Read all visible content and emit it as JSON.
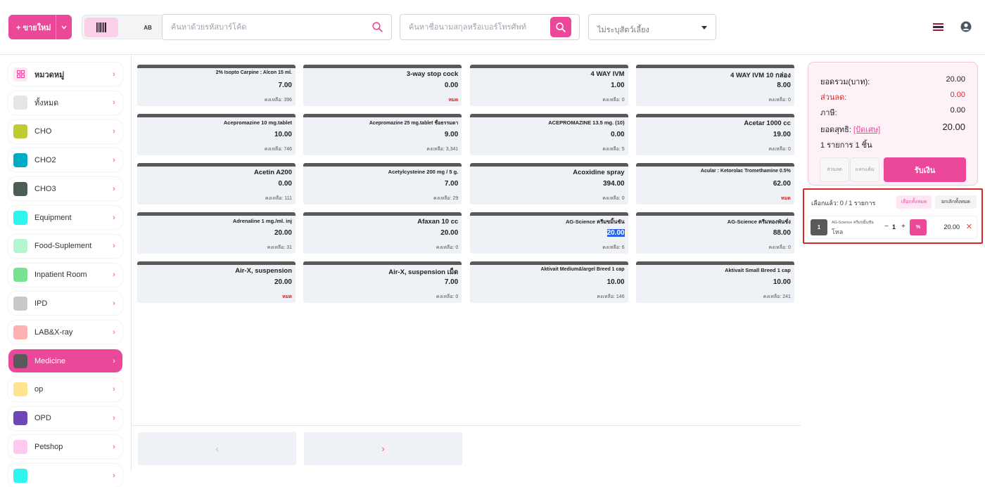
{
  "header": {
    "new_sale_label": "+ ขายใหม่",
    "mode_ab_label": "AB",
    "barcode_placeholder": "ค้นหาด้วยรหัสบาร์โค้ด",
    "customer_placeholder": "ค้นหาชื่อนามสกุลหรือเบอร์โทรศัพท์",
    "pet_select_value": "ไม่ระบุสัตว์เลี้ยง",
    "accent": "#ec4899"
  },
  "sidebar": {
    "items": [
      {
        "label": "หมวดหมู่",
        "color": "#fce7f3",
        "icon": "grid-icon"
      },
      {
        "label": "ทั้งหมด",
        "color": "#e5e5e5"
      },
      {
        "label": "CHO",
        "color": "#c0ca33"
      },
      {
        "label": "CHO2",
        "color": "#00acc1"
      },
      {
        "label": "CHO3",
        "color": "#4a5f52"
      },
      {
        "label": "Equipment",
        "color": "#2ff5ef"
      },
      {
        "label": "Food-Suplement",
        "color": "#b3f5cf"
      },
      {
        "label": "Inpatient Room",
        "color": "#77e28f"
      },
      {
        "label": "IPD",
        "color": "#c9c9c9"
      },
      {
        "label": "LAB&X-ray",
        "color": "#ffb0b0"
      },
      {
        "label": "Medicine",
        "color": "#595959",
        "active": true
      },
      {
        "label": "op",
        "color": "#ffe38f"
      },
      {
        "label": "OPD",
        "color": "#6e46b8"
      },
      {
        "label": "Petshop",
        "color": "#ffcaf0"
      },
      {
        "label": "",
        "color": "#2ff5ef"
      }
    ]
  },
  "products": [
    {
      "name": "2% Isopto Carpine : Alcon 15 ml.",
      "price": "7.00",
      "stock": "คงเหลือ: 396"
    },
    {
      "name": "3-way stop cock",
      "price": "0.00",
      "stock": "หมด",
      "out": true
    },
    {
      "name": "4 WAY IVM",
      "price": "1.00",
      "stock": "คงเหลือ: 0"
    },
    {
      "name": "4 WAY IVM 10 กล่อง",
      "price": "8.00",
      "stock": "คงเหลือ: 0"
    },
    {
      "name": "Acepromazine 10 mg.tablet",
      "price": "10.00",
      "stock": "คงเหลือ: 746"
    },
    {
      "name": "Acepromazine 25 mg.tablet ชื่อธรรมดา",
      "price": "9.00",
      "stock": "คงเหลือ: 3,341"
    },
    {
      "name": "ACEPROMAZINE 13.5 mg. (10)",
      "price": "0.00",
      "stock": "คงเหลือ: 5"
    },
    {
      "name": "Acetar 1000 cc",
      "price": "19.00",
      "stock": "คงเหลือ: 0"
    },
    {
      "name": "Acetin A200",
      "price": "0.00",
      "stock": "คงเหลือ: 111"
    },
    {
      "name": "Acetylcysteine 200 mg / 5 g.",
      "price": "7.00",
      "stock": "คงเหลือ: 29"
    },
    {
      "name": "Acoxidine spray",
      "price": "394.00",
      "stock": "คงเหลือ: 0"
    },
    {
      "name": "Acular : Ketorolac Tromethamine 0.5%",
      "price": "62.00",
      "stock": "หมด",
      "out": true
    },
    {
      "name": "Adrenaline 1 mg./ml. inj",
      "price": "20.00",
      "stock": "คงเหลือ: 31"
    },
    {
      "name": "Afaxan 10 cc",
      "price": "20.00",
      "stock": "คงเหลือ: 0"
    },
    {
      "name": "AG-Science ครีมขมิ้นชัน",
      "price": "20.00",
      "stock": "คงเหลือ: 6",
      "highlight": true
    },
    {
      "name": "AG-Science ครีมทองพันชั่ง",
      "price": "88.00",
      "stock": "คงเหลือ: 0"
    },
    {
      "name": "Air-X, suspension",
      "price": "20.00",
      "stock": "หมด",
      "out": true
    },
    {
      "name": "Air-X, suspension เม็ด",
      "price": "7.00",
      "stock": "คงเหลือ: 0"
    },
    {
      "name": "Aktivait Medium&largel Breed 1 cap",
      "price": "10.00",
      "stock": "คงเหลือ: 146"
    },
    {
      "name": "Aktivait Small Breed 1 cap",
      "price": "10.00",
      "stock": "คงเหลือ: 241"
    }
  ],
  "pager": {
    "prev": "‹",
    "next": "›"
  },
  "summary": {
    "total_label": "ยอดรวม(บาท):",
    "total_value": "20.00",
    "discount_label": "ส่วนลด:",
    "discount_value": "0.00",
    "tax_label": "ภาษี:",
    "tax_value": "0.00",
    "net_label": "ยอดสุทธิ:",
    "net_link": "[ปัดเศษ]",
    "net_value": "20.00",
    "count_text": "1 รายการ 1 ชิ้น",
    "discount_btn": "ส่วนลด",
    "redeem_btn": "แลกแต้ม",
    "pay_btn": "รับเงิน"
  },
  "selection": {
    "title": "เลือกแล้ว: 0 / 1 รายการ",
    "select_all": "เลือกทั้งหมด",
    "deselect_all": "ยกเลิกทั้งหมด",
    "item": {
      "badge": "1",
      "name": "AG-Science ครีมขมิ้นชัน",
      "unit": "โหล",
      "minus": "−",
      "qty": "1",
      "plus": "+",
      "pct": "%",
      "amount": "20.00",
      "remove": "✕"
    }
  }
}
